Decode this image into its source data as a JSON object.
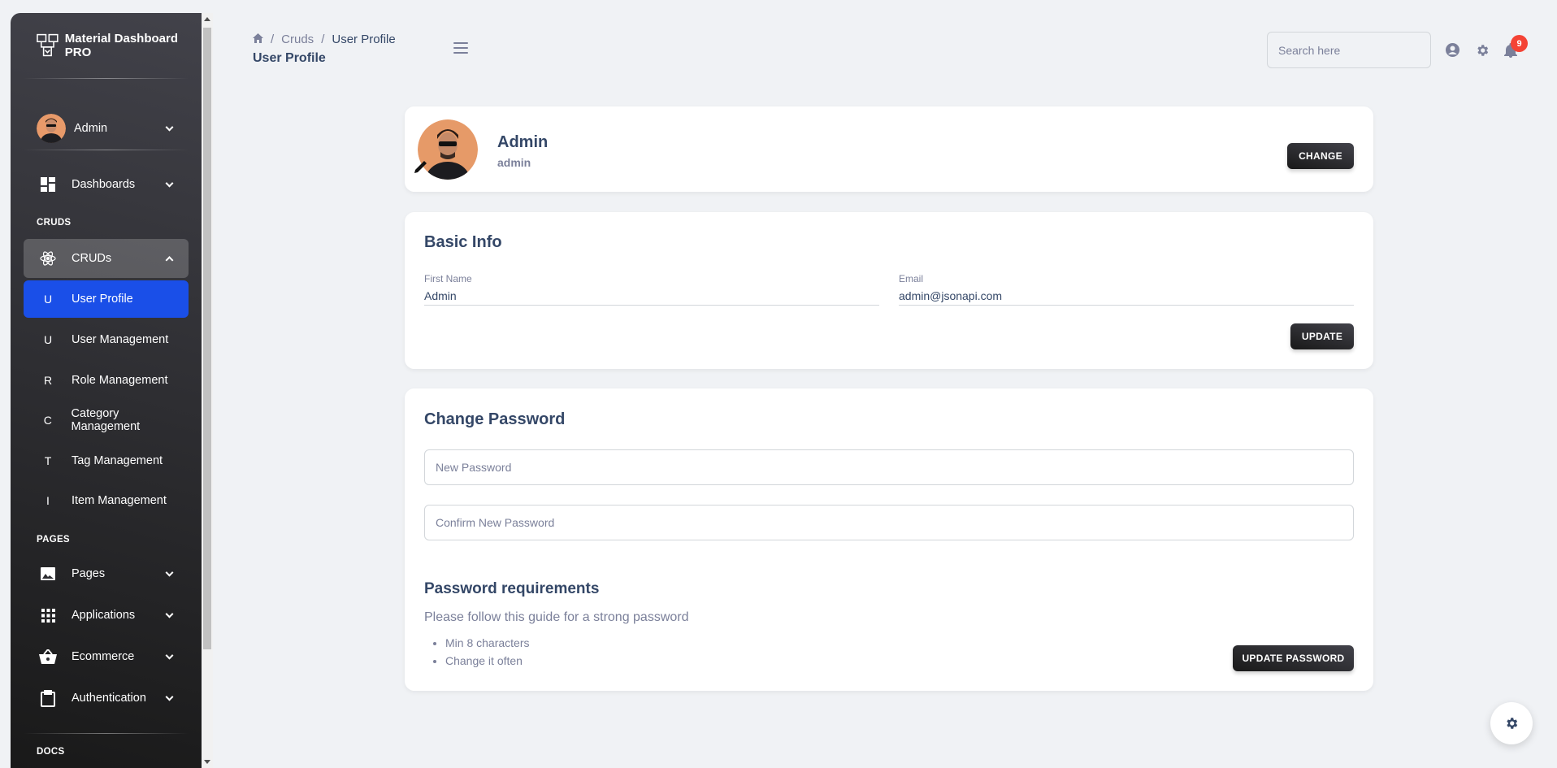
{
  "brand": {
    "title": "Material Dashboard PRO"
  },
  "sidebar": {
    "user": {
      "name": "Admin"
    },
    "dashboards": "Dashboards",
    "section_cruds": "CRUDS",
    "cruds": "CRUDs",
    "crud_items": [
      {
        "letter": "U",
        "label": "User Profile"
      },
      {
        "letter": "U",
        "label": "User Management"
      },
      {
        "letter": "R",
        "label": "Role Management"
      },
      {
        "letter": "C",
        "label": "Category Management"
      },
      {
        "letter": "T",
        "label": "Tag Management"
      },
      {
        "letter": "I",
        "label": "Item Management"
      }
    ],
    "section_pages": "PAGES",
    "pages": [
      {
        "label": "Pages",
        "icon": "image-icon"
      },
      {
        "label": "Applications",
        "icon": "apps-icon"
      },
      {
        "label": "Ecommerce",
        "icon": "basket-icon"
      },
      {
        "label": "Authentication",
        "icon": "clipboard-icon"
      }
    ],
    "section_docs": "DOCS"
  },
  "header": {
    "breadcrumb": {
      "parent": "Cruds",
      "current": "User Profile",
      "sep": "/"
    },
    "title": "User Profile",
    "search_placeholder": "Search here",
    "notification_count": "9"
  },
  "profile": {
    "name": "Admin",
    "role": "admin",
    "change_label": "CHANGE"
  },
  "basic_info": {
    "title": "Basic Info",
    "first_name_label": "First Name",
    "first_name": "Admin",
    "email_label": "Email",
    "email": "admin@jsonapi.com",
    "update_label": "UPDATE"
  },
  "password": {
    "title": "Change Password",
    "new_placeholder": "New Password",
    "confirm_placeholder": "Confirm New Password",
    "req_title": "Password requirements",
    "req_subtitle": "Please follow this guide for a strong password",
    "requirements": [
      "Min 8 characters",
      "Change it often"
    ],
    "update_label": "UPDATE PASSWORD"
  },
  "colors": {
    "active": "#1a4fe8",
    "badge": "#f44335",
    "dark": "#191919"
  }
}
